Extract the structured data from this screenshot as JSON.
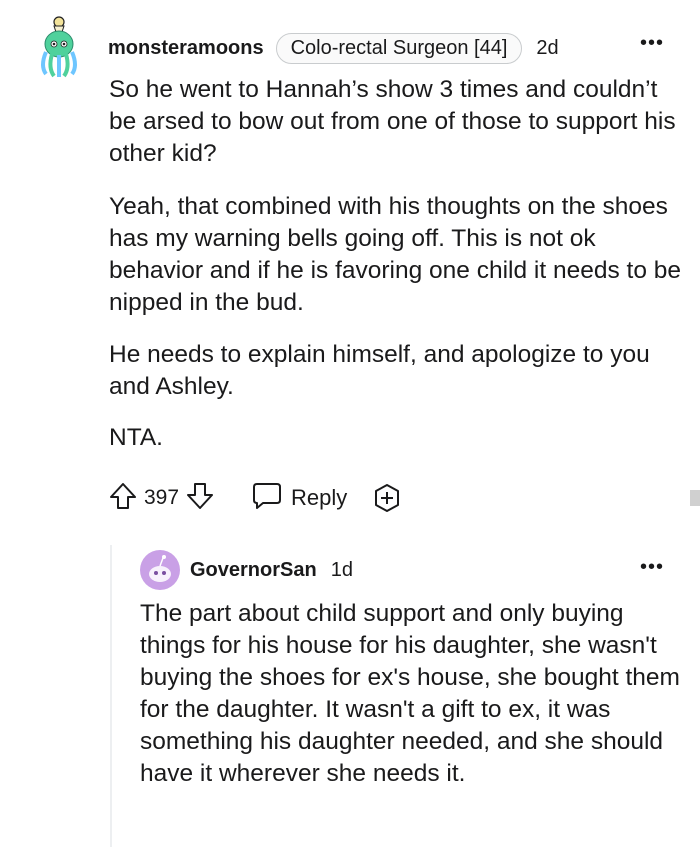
{
  "comment": {
    "username": "monsteramoons",
    "flair": "Colo-rectal Surgeon [44]",
    "age": "2d",
    "more": "•••",
    "paragraphs": [
      "So he went to Hannah’s show 3 times and couldn’t be arsed to bow out from one of those to support his other kid?",
      "Yeah, that combined with his thoughts on the shoes has my warning bells going off. This is not ok behavior and if he is favoring one child it needs to be nipped in the bud.",
      "He needs to explain himself, and apologize to you and Ashley.",
      "NTA."
    ],
    "votes": "397",
    "reply_label": "Reply",
    "avatar_icon": "octopus-avatar-icon"
  },
  "reply": {
    "username": "GovernorSan",
    "age": "1d",
    "more": "•••",
    "text": "The part about child support and only buying things for his house for his daughter, she wasn't buying the shoes for ex's house, she bought them for the daughter. It wasn't a gift to ex, it was something his daughter needed, and she should have it wherever she needs it.",
    "avatar_icon": "snoo-avatar-icon"
  },
  "colors": {
    "text": "#1a1a1b",
    "flair_border": "#c9ccce",
    "thread_line": "#edeff1",
    "avatar_green": "#4fd19c",
    "reply_avatar_purple": "#c9a0e6"
  }
}
